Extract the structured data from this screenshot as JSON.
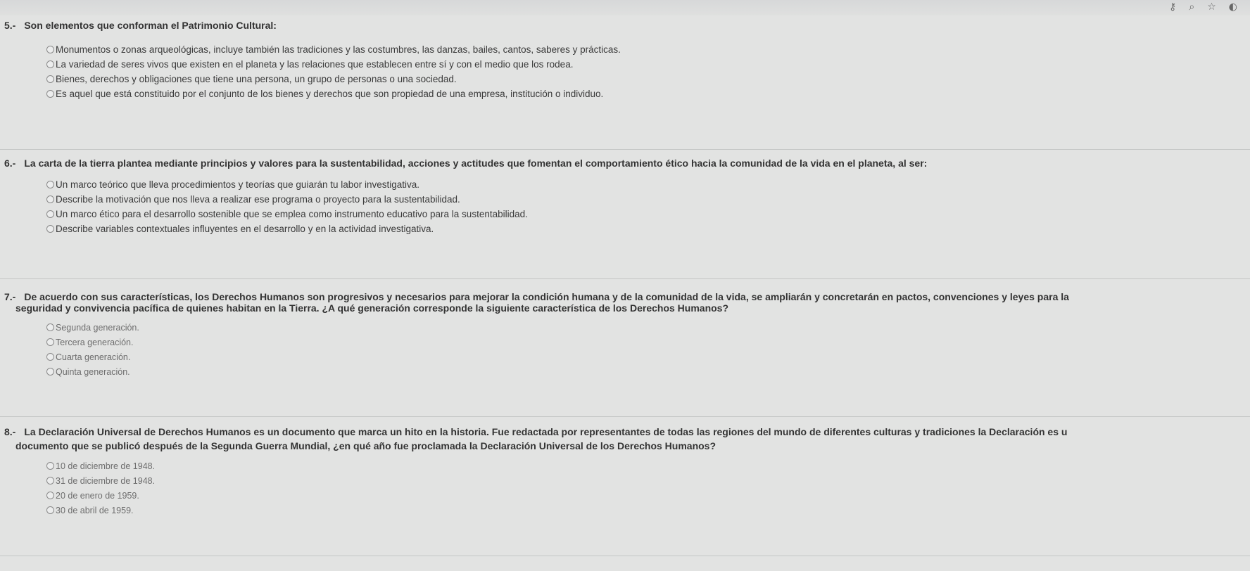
{
  "browser": {
    "icons": [
      "key-icon",
      "zoom-icon",
      "star-icon",
      "profile-icon"
    ]
  },
  "questions": [
    {
      "number": "5.-",
      "text": "Son elementos que conforman el Patrimonio Cultural:",
      "options": [
        "Monumentos o zonas arqueológicas, incluye también las tradiciones y las costumbres, las danzas, bailes, cantos, saberes y prácticas.",
        "La variedad de seres vivos que existen en el planeta y las relaciones que establecen entre sí y con el medio que los rodea.",
        "Bienes, derechos y obligaciones que tiene una persona, un grupo de personas o una sociedad.",
        "Es aquel que está constituido por el conjunto de los bienes y derechos que son propiedad de una empresa, institución o individuo."
      ]
    },
    {
      "number": "6.-",
      "text": "La carta de la tierra plantea mediante principios y valores para la sustentabilidad, acciones y actitudes que fomentan el comportamiento ético hacia la comunidad de la vida en el planeta, al ser:",
      "options": [
        "Un marco teórico que lleva procedimientos y teorías que guiarán tu labor investigativa.",
        "Describe la motivación que nos lleva a realizar ese programa o proyecto para la sustentabilidad.",
        "Un marco ético para el desarrollo sostenible que se emplea como instrumento educativo para la sustentabilidad.",
        "Describe variables contextuales influyentes en el desarrollo y en la actividad investigativa."
      ]
    },
    {
      "number": "7.-",
      "text": "De acuerdo con sus características, los Derechos Humanos son progresivos y necesarios para mejorar la condición humana y de la comunidad de la vida, se ampliarán y concretarán en pactos, convenciones y leyes para la",
      "text2": "seguridad y convivencia pacífica de quienes habitan en la Tierra. ¿A qué generación corresponde la siguiente característica de los Derechos Humanos?",
      "options": [
        "Segunda generación.",
        "Tercera generación.",
        "Cuarta generación.",
        "Quinta generación."
      ]
    },
    {
      "number": "8.-",
      "text": "La Declaración Universal de Derechos Humanos es un documento que marca un hito en la historia. Fue redactada por representantes de todas las regiones del mundo de diferentes culturas y tradiciones la Declaración es u",
      "text2": "documento que se publicó después de la Segunda Guerra Mundial, ¿en qué año fue proclamada la Declaración Universal de los Derechos Humanos?",
      "options": [
        "10 de diciembre de 1948.",
        "31 de diciembre de 1948.",
        "20 de enero de 1959.",
        "30 de abril de 1959."
      ]
    }
  ]
}
